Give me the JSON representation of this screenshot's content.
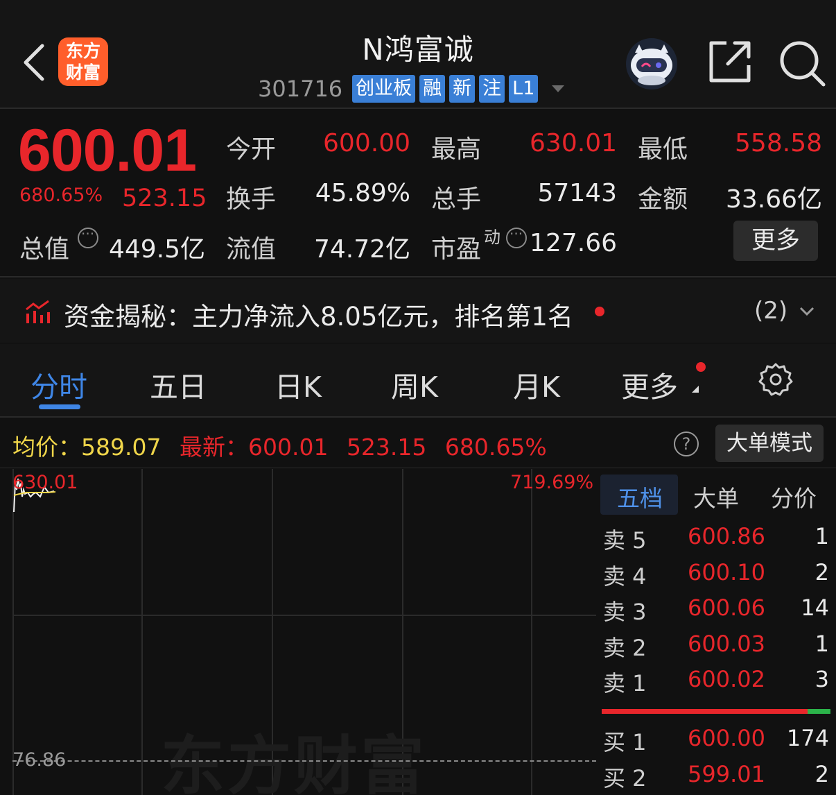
{
  "header": {
    "name": "N鸿富诚",
    "code": "301716",
    "tags": [
      "创业板",
      "融",
      "新",
      "注",
      "L1"
    ],
    "logo_line1": "东方",
    "logo_line2": "财富"
  },
  "quote": {
    "price": "600.01",
    "pct_change": "680.65%",
    "change": "523.15",
    "open_label": "今开",
    "open": "600.00",
    "high_label": "最高",
    "high": "630.01",
    "low_label": "最低",
    "low": "558.58",
    "turnover_label": "换手",
    "turnover": "45.89%",
    "volume_label": "总手",
    "volume": "57143",
    "amount_label": "金额",
    "amount": "33.66亿",
    "mktcap_label": "总值",
    "mktcap": "449.5亿",
    "float_label": "流值",
    "float_cap": "74.72亿",
    "pe_label": "市盈",
    "pe_sup": "动",
    "pe": "127.66",
    "more_label": "更多"
  },
  "fund_flow": {
    "text": "资金揭秘：主力净流入8.05亿元，排名第1名",
    "count": "(2)"
  },
  "tabs": [
    "分时",
    "五日",
    "日K",
    "周K",
    "月K",
    "更多"
  ],
  "chart_info": {
    "avg_label": "均价：",
    "avg": "589.07",
    "latest_label": "最新：",
    "latest": "600.01",
    "latest_chg": "523.15",
    "latest_pct": "680.65%",
    "bigorder_label": "大单模式",
    "help": "?"
  },
  "chart": {
    "hi_price": "630.01",
    "hi_pct": "719.69%",
    "lo_price": "76.86",
    "watermark": "东方财富"
  },
  "orderbook": {
    "tabs": [
      "五档",
      "大单",
      "分价"
    ],
    "rows": [
      {
        "label": "卖 5",
        "price": "600.86",
        "vol": "1"
      },
      {
        "label": "卖 4",
        "price": "600.10",
        "vol": "2"
      },
      {
        "label": "卖 3",
        "price": "600.06",
        "vol": "14"
      },
      {
        "label": "卖 2",
        "price": "600.03",
        "vol": "1"
      },
      {
        "label": "卖 1",
        "price": "600.02",
        "vol": "3"
      },
      {
        "label": "买 1",
        "price": "600.00",
        "vol": "174"
      },
      {
        "label": "买 2",
        "price": "599.01",
        "vol": "2"
      }
    ],
    "buy_ratio": 0.9
  },
  "colors": {
    "up": "#e8262b",
    "accent": "#3f86e6",
    "avg_line": "#f0d64a",
    "background": "#111111"
  }
}
